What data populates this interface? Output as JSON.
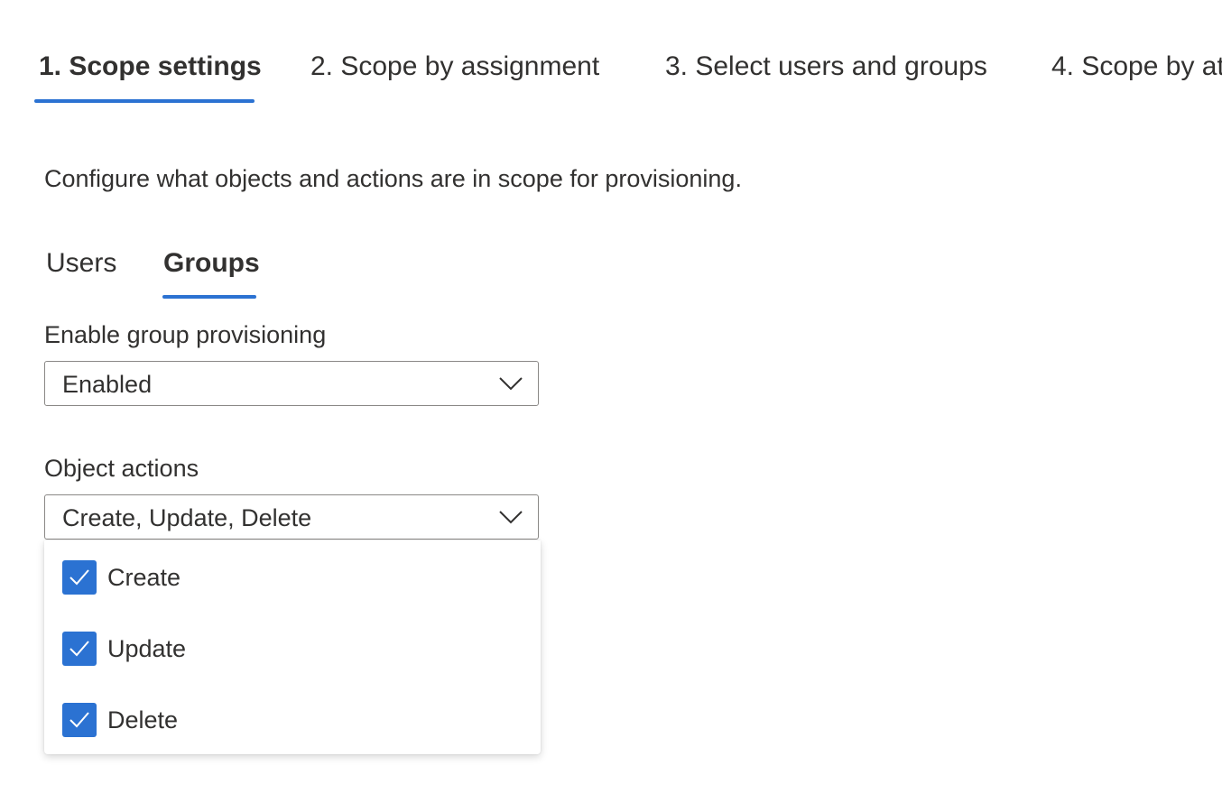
{
  "wizard": {
    "steps": [
      {
        "label": "1. Scope settings",
        "active": true
      },
      {
        "label": "2. Scope by assignment",
        "active": false
      },
      {
        "label": "3. Select users and groups",
        "active": false
      },
      {
        "label": "4. Scope by at",
        "active": false
      }
    ]
  },
  "description": "Configure what objects and actions are in scope for provisioning.",
  "tabs": [
    {
      "label": "Users",
      "active": false
    },
    {
      "label": "Groups",
      "active": true
    }
  ],
  "group_provisioning": {
    "label": "Enable group provisioning",
    "value": "Enabled"
  },
  "object_actions": {
    "label": "Object actions",
    "value": "Create, Update, Delete",
    "options": [
      {
        "label": "Create",
        "checked": true
      },
      {
        "label": "Update",
        "checked": true
      },
      {
        "label": "Delete",
        "checked": true
      }
    ]
  },
  "icons": {
    "dropdown": "chevron-down-icon",
    "check": "checkmark-icon"
  },
  "colors": {
    "accent": "#2b72d2",
    "text": "#323130",
    "border": "#8a8886"
  }
}
